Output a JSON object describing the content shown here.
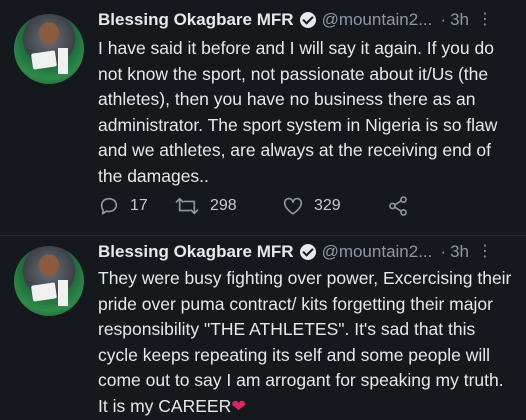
{
  "tweets": [
    {
      "name": "Blessing Okagbare MFR",
      "handle": "@mountain2...",
      "time": "3h",
      "text": "I have said it before and I will say it again. If you do not know the sport, not passionate about it/Us (the athletes), then you have no business there as an administrator. The sport system in Nigeria is so flaw and we athletes, are always at the receiving end of the damages..",
      "replies": "17",
      "retweets": "298",
      "likes": "329"
    },
    {
      "name": "Blessing Okagbare MFR",
      "handle": "@mountain2...",
      "time": "3h",
      "text": "They were busy fighting over power, Excercising their pride over puma contract/ kits forgetting their major responsibility \"THE ATHLETES\". It's sad that this cycle keeps repeating its self and some people will come out to say I am arrogant for speaking my truth. It is my CAREER",
      "emoji": "❤"
    }
  ],
  "separator": "·",
  "icons": {
    "verified": "verified-badge-icon",
    "more": "more-options-icon",
    "reply": "reply-icon",
    "retweet": "retweet-icon",
    "like": "like-icon",
    "share": "share-icon"
  },
  "colors": {
    "background": "#15181c",
    "text": "#e7e9ea",
    "muted": "#8b98a5",
    "heart": "#e0245e"
  }
}
